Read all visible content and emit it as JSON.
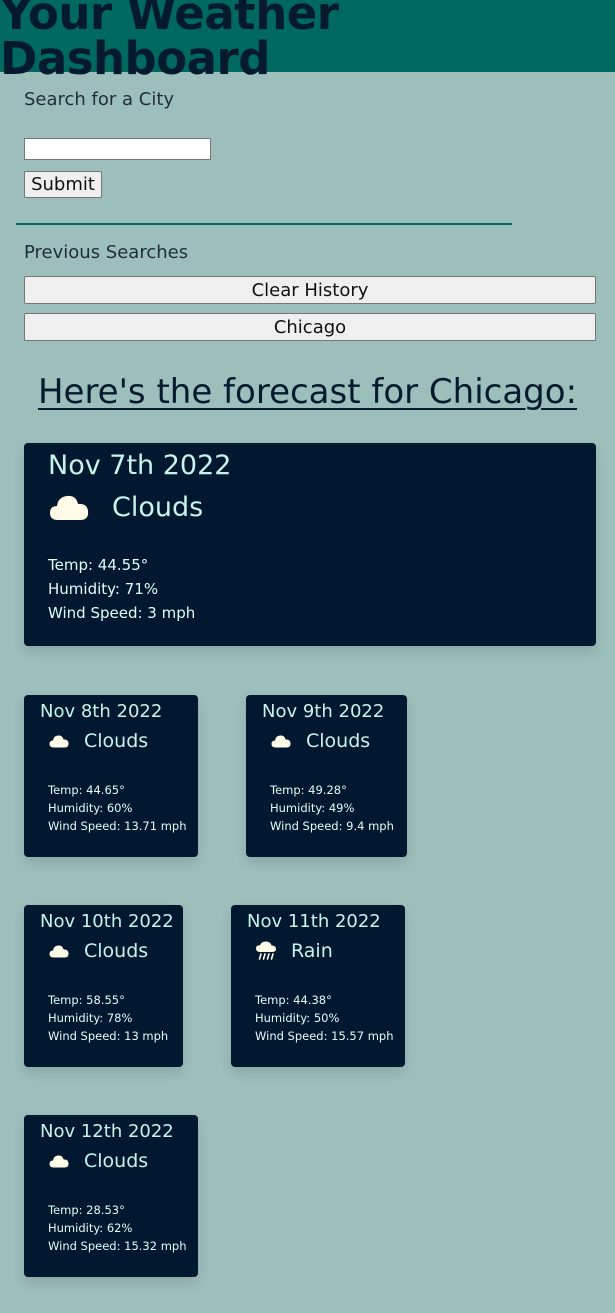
{
  "header": {
    "title": "Your Weather Dashboard"
  },
  "search": {
    "label": "Search for a City",
    "input_value": "",
    "submit_label": "Submit"
  },
  "history": {
    "label": "Previous Searches",
    "clear_label": "Clear History",
    "items": [
      "Chicago"
    ]
  },
  "forecast": {
    "heading": "Here's the forecast for Chicago:",
    "current": {
      "date": "Nov 7th 2022",
      "icon": "cloud-icon",
      "condition": "Clouds",
      "temp": "Temp: 44.55°",
      "humidity": "Humidity: 71%",
      "wind": "Wind Speed: 3 mph"
    },
    "days": [
      {
        "date": "Nov 8th 2022",
        "icon": "cloud-icon",
        "condition": "Clouds",
        "temp": "Temp: 44.65°",
        "humidity": "Humidity: 60%",
        "wind": "Wind Speed: 13.71 mph"
      },
      {
        "date": "Nov 9th 2022",
        "icon": "cloud-icon",
        "condition": "Clouds",
        "temp": "Temp: 49.28°",
        "humidity": "Humidity: 49%",
        "wind": "Wind Speed: 9.4 mph"
      },
      {
        "date": "Nov 10th 2022",
        "icon": "cloud-icon",
        "condition": "Clouds",
        "temp": "Temp: 58.55°",
        "humidity": "Humidity: 78%",
        "wind": "Wind Speed: 13 mph"
      },
      {
        "date": "Nov 11th 2022",
        "icon": "rain-icon",
        "condition": "Rain",
        "temp": "Temp: 44.38°",
        "humidity": "Humidity: 50%",
        "wind": "Wind Speed: 15.57 mph"
      },
      {
        "date": "Nov 12th 2022",
        "icon": "cloud-icon",
        "condition": "Clouds",
        "temp": "Temp: 28.53°",
        "humidity": "Humidity: 62%",
        "wind": "Wind Speed: 15.32 mph"
      }
    ]
  },
  "colors": {
    "background": "#9dbfbc",
    "header": "#00695f",
    "card": "#011830",
    "card_text": "#c7f3e8",
    "icon": "#fffbe6"
  }
}
